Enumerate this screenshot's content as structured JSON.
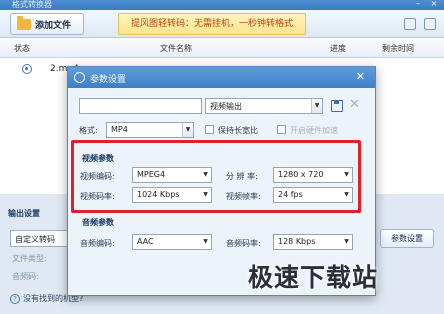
{
  "window": {
    "title": "格式转换器"
  },
  "toolbar": {
    "add_file_label": "添加文件",
    "promo_text": "提风图轻转码：无需挂机，一秒钟转格式"
  },
  "list": {
    "columns": {
      "status": "状态",
      "filename": "文件名称",
      "progress": "进度",
      "remaining": "剩余时间"
    },
    "rows": [
      {
        "filename": "2.mp4"
      }
    ]
  },
  "output_settings": {
    "title": "输出设置",
    "preset": "自定义转码",
    "file_type_label": "文件类型:",
    "audio_label": "音频码:",
    "param_button": "参数设置",
    "help_text": "没有找到的机型?"
  },
  "dialog": {
    "title": "参数设置",
    "output_path": "",
    "output_mode": "视频输出",
    "format_label": "格式:",
    "format_value": "MP4",
    "keep_ratio_label": "保持长宽比",
    "hw_accel_label": "开启硬件加速",
    "video": {
      "title": "视频参数",
      "codec_label": "视频编码:",
      "codec_value": "MPEG4",
      "resolution_label": "分 辨 率:",
      "resolution_value": "1280 x 720",
      "bitrate_label": "视频码率:",
      "bitrate_value": "1024 Kbps",
      "framerate_label": "视频帧率:",
      "framerate_value": "24 fps"
    },
    "audio": {
      "title": "音频参数",
      "codec_label": "音频编码:",
      "codec_value": "AAC",
      "bitrate_label": "音频码率:",
      "bitrate_value": "128 Kbps"
    }
  },
  "watermark": "极速下载站",
  "colors": {
    "highlight": "#e0202a",
    "titlebar": "#3e7fc4",
    "promo_text": "#c2410c"
  }
}
